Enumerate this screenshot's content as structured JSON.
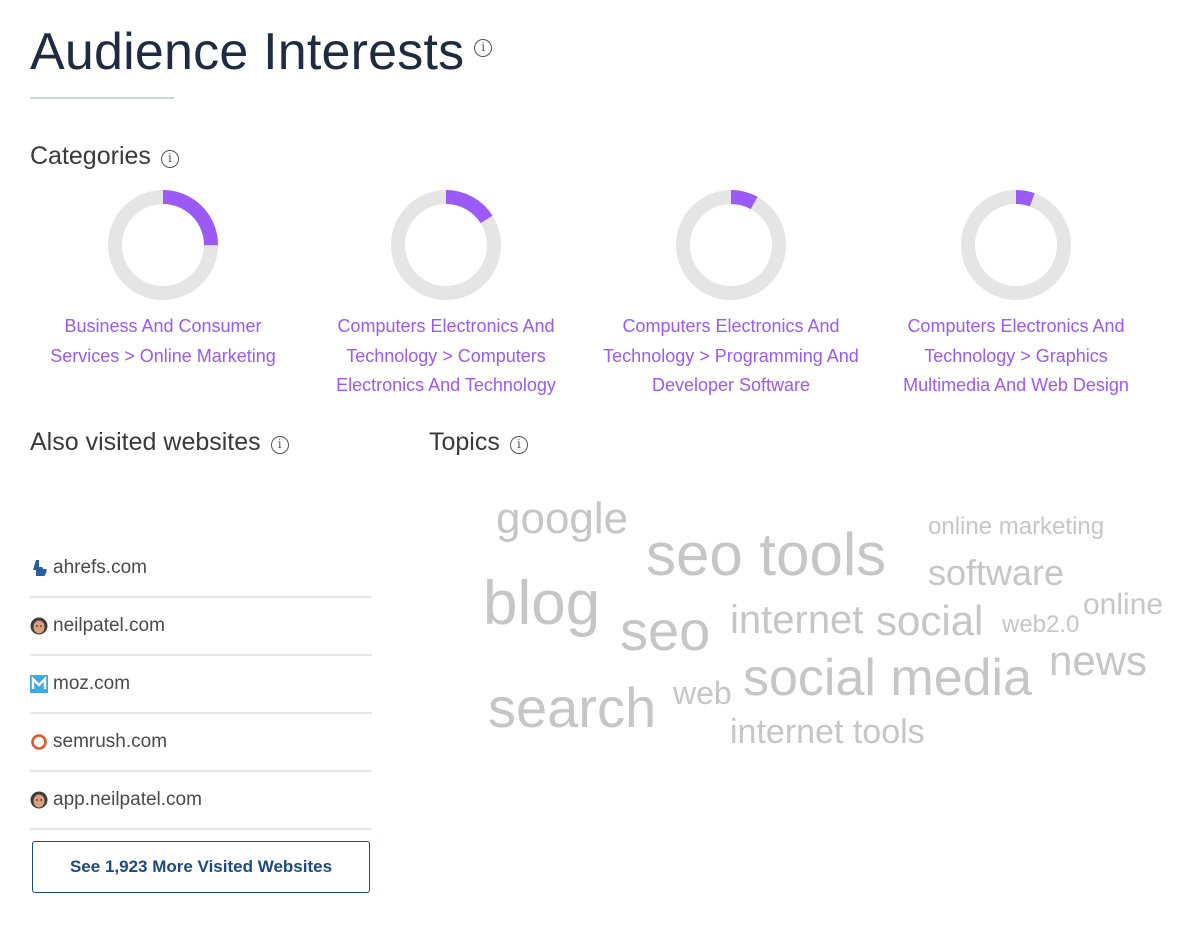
{
  "header": {
    "title": "Audience Interests"
  },
  "categories": {
    "title": "Categories",
    "items": [
      {
        "label": "Business And Consumer Services > Online Marketing",
        "share": 0.25
      },
      {
        "label": "Computers Electronics And Technology > Computers Electronics And Technology",
        "share": 0.16
      },
      {
        "label": "Computers Electronics And Technology > Programming And Developer Software",
        "share": 0.08
      },
      {
        "label": "Computers Electronics And Technology > Graphics Multimedia And Web Design",
        "share": 0.055
      }
    ],
    "colors": {
      "accent": "#9b59f5",
      "track": "#e5e5e5"
    }
  },
  "also_visited": {
    "title": "Also visited websites",
    "sites": [
      {
        "name": "ahrefs.com",
        "icon": "ahrefs-icon"
      },
      {
        "name": "neilpatel.com",
        "icon": "neilpatel-avatar-icon"
      },
      {
        "name": "moz.com",
        "icon": "moz-icon"
      },
      {
        "name": "semrush.com",
        "icon": "semrush-icon"
      },
      {
        "name": "app.neilpatel.com",
        "icon": "neilpatel-avatar-icon"
      }
    ],
    "more_button": "See 1,923 More Visited Websites"
  },
  "topics": {
    "title": "Topics",
    "words": [
      "google",
      "seo tools",
      "online marketing",
      "software",
      "online",
      "blog",
      "seo",
      "internet",
      "social",
      "web2.0",
      "news",
      "search",
      "web",
      "social media",
      "internet tools"
    ]
  }
}
